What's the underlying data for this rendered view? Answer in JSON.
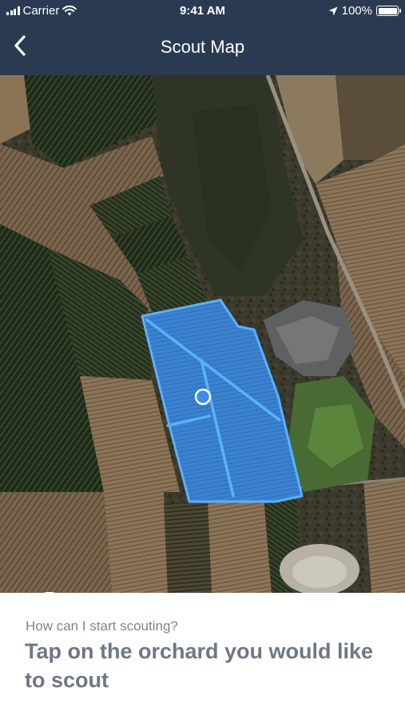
{
  "status_bar": {
    "carrier": "Carrier",
    "time": "9:41 AM",
    "battery": "100%",
    "icons": [
      "signal-icon",
      "wifi-icon",
      "location-arrow-icon",
      "battery-icon"
    ]
  },
  "nav": {
    "title": "Scout Map",
    "back_icon": "chevron-left-icon"
  },
  "map": {
    "type": "satellite",
    "selected_orchard_color": "#3a86d8",
    "selected_orchard_outline": "#5ab0ff",
    "user_location_color": "#3f8cf0",
    "locate_button_icon": "crosshair-icon"
  },
  "sheet": {
    "question": "How can I start scouting?",
    "instruction": "Tap on the orchard you would like to scout"
  },
  "colors": {
    "header_bg": "#2a3a52",
    "text_gray": "#7d8591"
  }
}
